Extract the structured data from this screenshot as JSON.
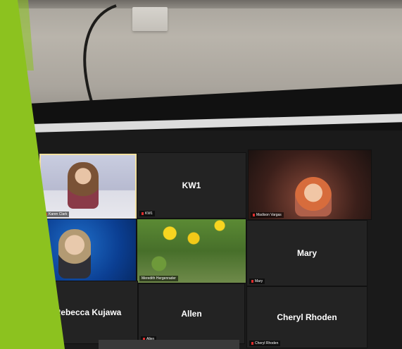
{
  "zoom_grid": {
    "tiles": [
      {
        "type": "video",
        "scene": "office-presenter",
        "active": true,
        "label": "Karen Clark"
      },
      {
        "type": "name",
        "name": "KW1",
        "label": "KW1"
      },
      {
        "type": "video",
        "scene": "red-room",
        "label": "Madison Vargas"
      },
      {
        "type": "video",
        "scene": "blue-background",
        "label": ""
      },
      {
        "type": "video",
        "scene": "flowers",
        "label": "Meredith Hergenrader"
      },
      {
        "type": "name",
        "name": "Mary",
        "label": "Mary"
      },
      {
        "type": "name",
        "name": "Rebecca Kujawa",
        "label": ""
      },
      {
        "type": "name",
        "name": "Allen",
        "label": "Allen"
      },
      {
        "type": "name",
        "name": "Cheryl Rhoden",
        "label": "Cheryl Rhoden"
      }
    ]
  },
  "colors": {
    "accent_green": "#8cc21f",
    "active_speaker_border": "#f2e0a0",
    "muted_mic": "#e02d2d"
  }
}
